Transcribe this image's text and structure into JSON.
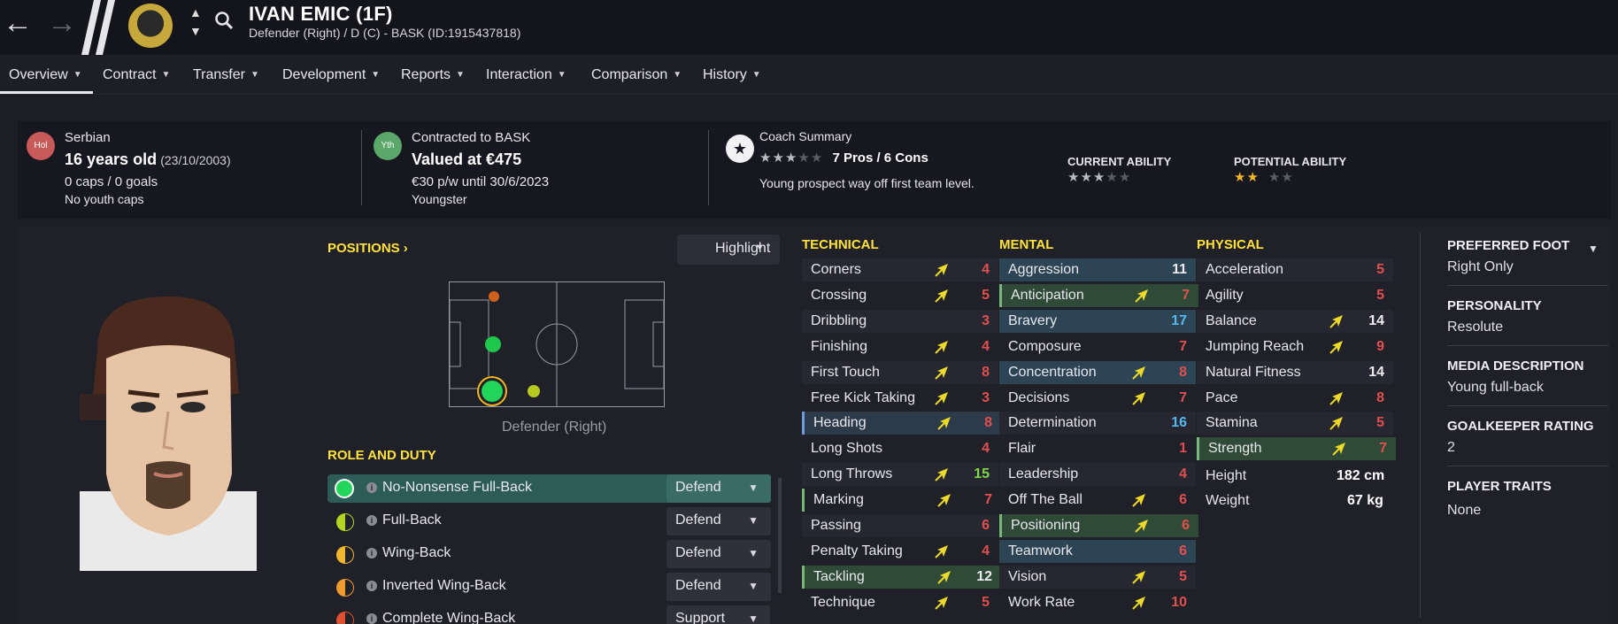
{
  "header": {
    "name": "IVAN EMIC (1F)",
    "subtitle": "Defender (Right) / D (C) - BASK (ID:1915437818)"
  },
  "menu": [
    "Overview",
    "Contract",
    "Transfer",
    "Development",
    "Reports",
    "Interaction",
    "Comparison",
    "History"
  ],
  "summary": {
    "nationality": "Serbian",
    "nation_code": "Hol",
    "age": "16 years old",
    "dob": "(23/10/2003)",
    "caps": "0 caps / 0 goals",
    "youth_caps": "No youth caps",
    "contract_code": "Yth",
    "contracted": "Contracted to BASK",
    "valued": "Valued at €475",
    "wage": "€30 p/w until 30/6/2023",
    "contract_type": "Youngster",
    "coach_summary_title": "Coach Summary",
    "pros_cons": "7 Pros / 6 Cons",
    "coach_rating": 3,
    "coach_text": "Young prospect way off first team level.",
    "current_ability_label": "CURRENT ABILITY",
    "current_ability": 3,
    "potential_ability_label": "POTENTIAL ABILITY",
    "potential_ability": 2
  },
  "positions": {
    "title": "POSITIONS",
    "highlight": "Highlight",
    "label": "Defender (Right)"
  },
  "roles": {
    "title": "ROLE AND DUTY",
    "items": [
      {
        "name": "No-Nonsense Full-Back",
        "duty": "Defend",
        "color": "#22d65a"
      },
      {
        "name": "Full-Back",
        "duty": "Defend",
        "color": "#b5d323"
      },
      {
        "name": "Wing-Back",
        "duty": "Defend",
        "color": "#f0b630"
      },
      {
        "name": "Inverted Wing-Back",
        "duty": "Defend",
        "color": "#f09a30"
      },
      {
        "name": "Complete Wing-Back",
        "duty": "Support",
        "color": "#e05030"
      }
    ]
  },
  "technical": {
    "title": "TECHNICAL",
    "items": [
      {
        "name": "Corners",
        "value": "4",
        "arrow": true
      },
      {
        "name": "Crossing",
        "value": "5",
        "arrow": true
      },
      {
        "name": "Dribbling",
        "value": "3",
        "arrow": false
      },
      {
        "name": "Finishing",
        "value": "4",
        "arrow": true
      },
      {
        "name": "First Touch",
        "value": "8",
        "arrow": true
      },
      {
        "name": "Free Kick Taking",
        "value": "3",
        "arrow": true
      },
      {
        "name": "Heading",
        "value": "8",
        "arrow": true
      },
      {
        "name": "Long Shots",
        "value": "4",
        "arrow": false
      },
      {
        "name": "Long Throws",
        "value": "15",
        "arrow": true
      },
      {
        "name": "Marking",
        "value": "7",
        "arrow": true
      },
      {
        "name": "Passing",
        "value": "6",
        "arrow": false
      },
      {
        "name": "Penalty Taking",
        "value": "4",
        "arrow": true
      },
      {
        "name": "Tackling",
        "value": "12",
        "arrow": true
      },
      {
        "name": "Technique",
        "value": "5",
        "arrow": true
      }
    ]
  },
  "mental": {
    "title": "MENTAL",
    "items": [
      {
        "name": "Aggression",
        "value": "11",
        "arrow": false
      },
      {
        "name": "Anticipation",
        "value": "7",
        "arrow": true
      },
      {
        "name": "Bravery",
        "value": "17",
        "arrow": false
      },
      {
        "name": "Composure",
        "value": "7",
        "arrow": false
      },
      {
        "name": "Concentration",
        "value": "8",
        "arrow": true
      },
      {
        "name": "Decisions",
        "value": "7",
        "arrow": true
      },
      {
        "name": "Determination",
        "value": "16",
        "arrow": false
      },
      {
        "name": "Flair",
        "value": "1",
        "arrow": false
      },
      {
        "name": "Leadership",
        "value": "4",
        "arrow": false
      },
      {
        "name": "Off The Ball",
        "value": "6",
        "arrow": true
      },
      {
        "name": "Positioning",
        "value": "6",
        "arrow": true
      },
      {
        "name": "Teamwork",
        "value": "6",
        "arrow": false
      },
      {
        "name": "Vision",
        "value": "5",
        "arrow": true
      },
      {
        "name": "Work Rate",
        "value": "10",
        "arrow": true
      }
    ]
  },
  "physical": {
    "title": "PHYSICAL",
    "items": [
      {
        "name": "Acceleration",
        "value": "5",
        "arrow": false
      },
      {
        "name": "Agility",
        "value": "5",
        "arrow": false
      },
      {
        "name": "Balance",
        "value": "14",
        "arrow": true
      },
      {
        "name": "Jumping Reach",
        "value": "9",
        "arrow": true
      },
      {
        "name": "Natural Fitness",
        "value": "14",
        "arrow": false
      },
      {
        "name": "Pace",
        "value": "8",
        "arrow": true
      },
      {
        "name": "Stamina",
        "value": "5",
        "arrow": true
      },
      {
        "name": "Strength",
        "value": "7",
        "arrow": true
      }
    ],
    "height_label": "Height",
    "height": "182 cm",
    "weight_label": "Weight",
    "weight": "67 kg"
  },
  "info": {
    "preferred_foot_label": "PREFERRED FOOT",
    "preferred_foot": "Right Only",
    "personality_label": "PERSONALITY",
    "personality": "Resolute",
    "media_label": "MEDIA DESCRIPTION",
    "media": "Young full-back",
    "gk_label": "GOALKEEPER RATING",
    "gk": "2",
    "traits_label": "PLAYER TRAITS",
    "traits": "None"
  }
}
